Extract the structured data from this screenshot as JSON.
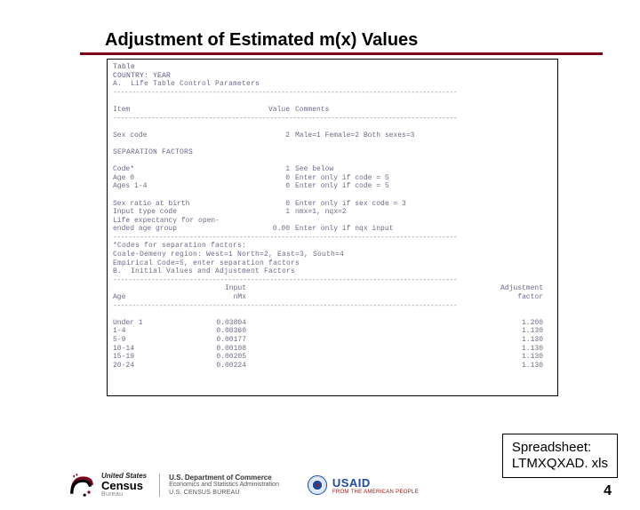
{
  "title": "Adjustment of Estimated m(x) Values",
  "table": {
    "l_table": "Table",
    "l_country": "COUNTRY: YEAR",
    "l_sectionA": "A.  Life Table Control Parameters",
    "dash": "------------------------------------------------------------------------------------------",
    "h_item": "Item",
    "h_value": "Value",
    "h_comments": "Comments",
    "sex_label": "Sex code",
    "sex_val": "2",
    "sex_cmt": "Male=1 Female=2 Both sexes=3",
    "sep_title": "SEPARATION FACTORS",
    "code_label": "Code*",
    "code_val": "1",
    "code_cmt": "See below",
    "age0_label": "Age 0",
    "age0_val": "0",
    "age0_cmt": "Enter only if code = 5",
    "age14_label": "Ages 1-4",
    "age14_val": "0",
    "age14_cmt": "Enter only if code = 5",
    "srb_label": "Sex ratio at birth",
    "srb_val": "0",
    "srb_cmt": "Enter only if sex code = 3",
    "itc_label": "Input type code",
    "itc_val": "1",
    "itc_cmt": "nmx=1, nqx=2",
    "le_label": "Life expectancy for open-",
    "le_label2": "  ended age group",
    "le_val": "0.00",
    "le_cmt": "Enter only if nqx input",
    "note1": "*Codes for separation factors:",
    "note2": "Coale-Demeny region: West=1 North=2, East=3, South=4",
    "note3": "Empirical Code=5, enter separation factors",
    "l_sectionB": "B.  Initial Values and Adjustment Factors",
    "bh_age": "Age",
    "bh_nmx": "nMx",
    "bh_input": "Input",
    "bh_adj": "Adjustment",
    "bh_factor": "factor",
    "rows": [
      {
        "age": "Under 1",
        "nmx": "0.03804",
        "adj": "1.200"
      },
      {
        "age": "1-4",
        "nmx": "0.00360",
        "adj": "1.130"
      },
      {
        "age": "5-9",
        "nmx": "0.00177",
        "adj": "1.130"
      },
      {
        "age": "10-14",
        "nmx": "0.00108",
        "adj": "1.130"
      },
      {
        "age": "15-19",
        "nmx": "0.00205",
        "adj": "1.130"
      },
      {
        "age": "20-24",
        "nmx": "0.00224",
        "adj": "1.130"
      }
    ]
  },
  "spreadsheet": {
    "l1": "Spreadsheet:",
    "l2": "LTMXQXAD. xls"
  },
  "page_number": "4",
  "footer": {
    "census_us": "United States",
    "census_word": "Census",
    "census_bureau": "Bureau",
    "doc1": "U.S. Department of Commerce",
    "doc2": "Economics and Statistics Administration",
    "doc3": "U.S. CENSUS BUREAU",
    "usaid": "USAID",
    "usaid_sub": "FROM THE AMERICAN PEOPLE"
  }
}
